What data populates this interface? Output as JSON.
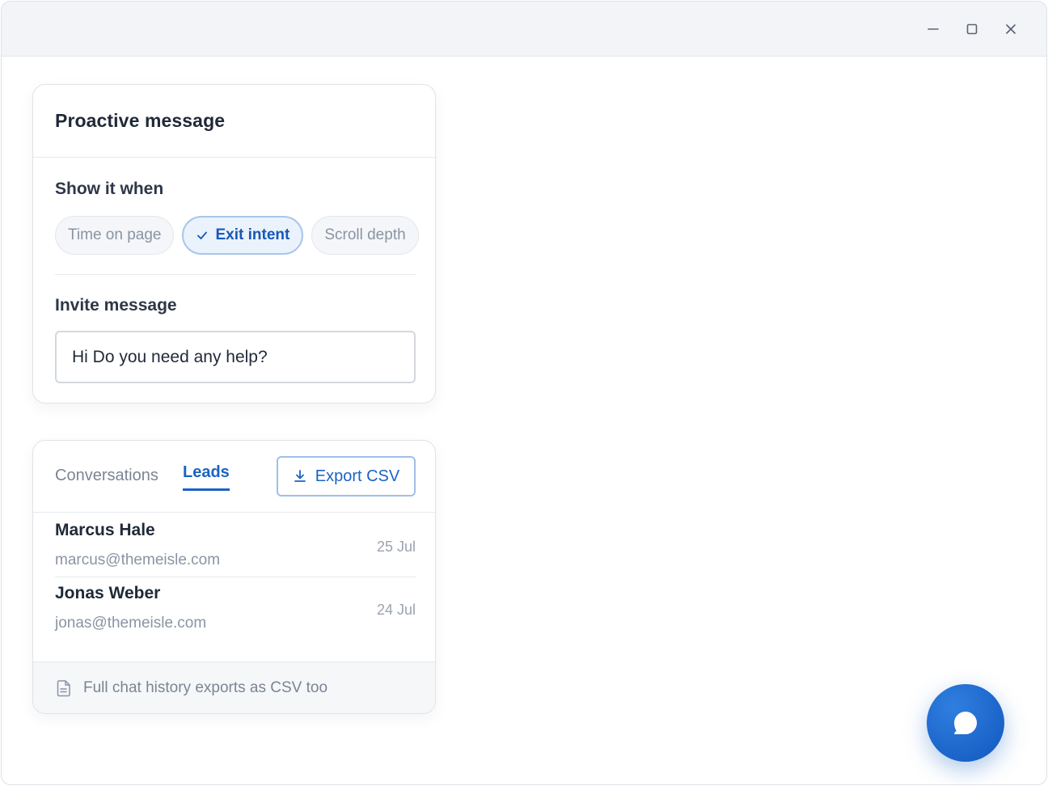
{
  "window": {
    "controls": {
      "minimize": "minimize-icon",
      "maximize": "maximize-icon",
      "close": "close-icon"
    }
  },
  "proactive": {
    "title": "Proactive message",
    "show_it_when_label": "Show it when",
    "triggers": [
      {
        "label": "Time on page",
        "selected": false
      },
      {
        "label": "Exit intent",
        "selected": true
      },
      {
        "label": "Scroll depth",
        "selected": false
      }
    ],
    "invite_label": "Invite message",
    "invite_value": "Hi Do you need any help?"
  },
  "leads": {
    "tabs": [
      {
        "label": "Conversations",
        "active": false
      },
      {
        "label": "Leads",
        "active": true
      }
    ],
    "export_label": "Export CSV",
    "export_icon": "download-icon",
    "rows": [
      {
        "name": "Marcus Hale",
        "email": "marcus@themeisle.com",
        "date": "25 Jul"
      },
      {
        "name": "Jonas Weber",
        "email": "jonas@themeisle.com",
        "date": "24 Jul"
      }
    ],
    "footer_icon": "document-icon",
    "footer_text": "Full chat history exports as CSV too"
  },
  "chat_launcher": {
    "icon": "chat-bubble-icon"
  },
  "colors": {
    "accent": "#1a63c4",
    "launcher": "#1a63c4",
    "chip_active_bg": "#eaf2fc",
    "titlebar": "#f2f4f7"
  }
}
